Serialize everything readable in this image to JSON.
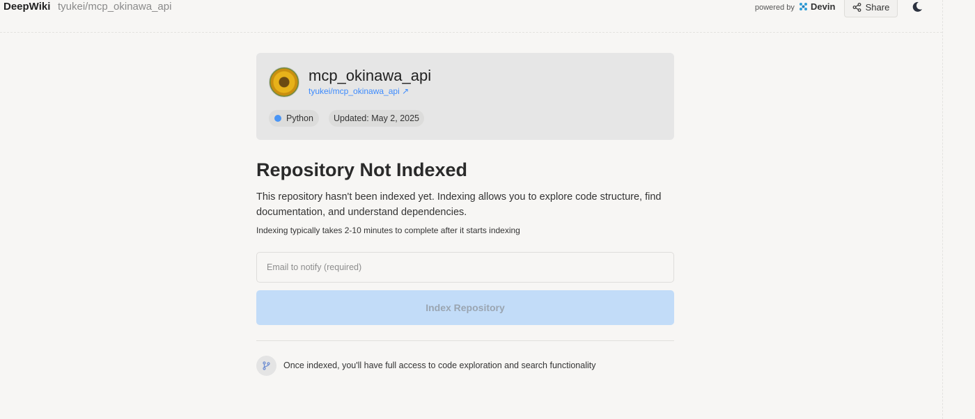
{
  "header": {
    "brand": "DeepWiki",
    "repo_path": "tyukei/mcp_okinawa_api",
    "powered_by": "powered by",
    "devin_label": "Devin",
    "share_label": "Share"
  },
  "repo_card": {
    "name": "mcp_okinawa_api",
    "link_text": "tyukei/mcp_okinawa_api ↗",
    "language": "Python",
    "language_color": "#4a95f5",
    "updated": "Updated: May 2, 2025"
  },
  "main": {
    "title": "Repository Not Indexed",
    "description": "This repository hasn't been indexed yet. Indexing allows you to explore code structure, find documentation, and understand dependencies.",
    "note": "Indexing typically takes 2-10 minutes to complete after it starts indexing",
    "email_placeholder": "Email to notify (required)",
    "email_value": "",
    "index_button": "Index Repository",
    "info_text": "Once indexed, you'll have full access to code exploration and search functionality"
  },
  "colors": {
    "accent": "#3d8bfd",
    "button_disabled_bg": "#c2dcf8",
    "background": "#f7f6f4"
  }
}
